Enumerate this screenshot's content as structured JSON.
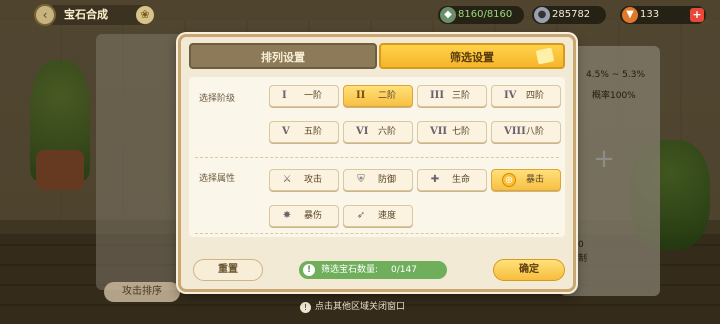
{
  "topbar": {
    "title": "宝石合成",
    "resources": [
      {
        "icon": "gem-currency-icon",
        "value": "8160/8160"
      },
      {
        "icon": "silver-coin-icon",
        "value": "285782"
      },
      {
        "icon": "carrot-icon",
        "value": "133"
      }
    ]
  },
  "background": {
    "range_text": "4.5% ~ 5.3%",
    "prob_text": "概率100%",
    "sort_button": "攻击排序",
    "hint": "点击其他区域关闭窗口",
    "side_lines": [
      "0",
      "制"
    ]
  },
  "dialog": {
    "tabs": [
      {
        "label": "排列设置",
        "active": false
      },
      {
        "label": "筛选设置",
        "active": true
      }
    ],
    "grade_label": "选择阶级",
    "grades": [
      {
        "numeral": "I",
        "label": "一阶",
        "selected": false
      },
      {
        "numeral": "II",
        "label": "二阶",
        "selected": true
      },
      {
        "numeral": "III",
        "label": "三阶",
        "selected": false
      },
      {
        "numeral": "IV",
        "label": "四阶",
        "selected": false
      },
      {
        "numeral": "V",
        "label": "五阶",
        "selected": false
      },
      {
        "numeral": "VI",
        "label": "六阶",
        "selected": false
      },
      {
        "numeral": "VII",
        "label": "七阶",
        "selected": false
      },
      {
        "numeral": "VIII",
        "label": "八阶",
        "selected": false
      }
    ],
    "attr_label": "选择属性",
    "attributes": [
      {
        "icon": "sword-icon",
        "glyph": "⚔",
        "label": "攻击",
        "selected": false
      },
      {
        "icon": "shield-icon",
        "glyph": "⛨",
        "label": "防御",
        "selected": false
      },
      {
        "icon": "health-cross-icon",
        "glyph": "✚",
        "label": "生命",
        "selected": false
      },
      {
        "icon": "crosshair-icon",
        "glyph": "⊕",
        "label": "暴击",
        "selected": true
      },
      {
        "icon": "burst-icon",
        "glyph": "✸",
        "label": "暴伤",
        "selected": false
      },
      {
        "icon": "wing-icon",
        "glyph": "➶",
        "label": "速度",
        "selected": false
      }
    ],
    "reset_label": "重置",
    "count_label": "筛选宝石数量:",
    "count_value": "0/147",
    "confirm_label": "确定"
  }
}
